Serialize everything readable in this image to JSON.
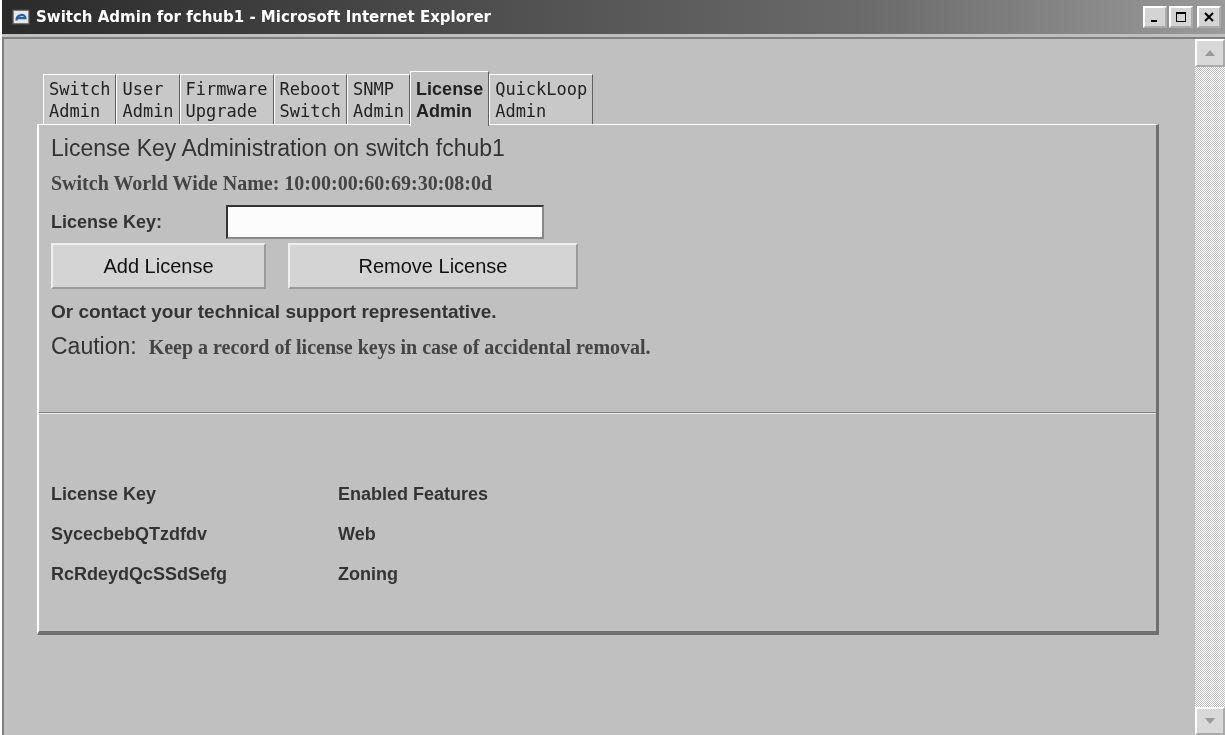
{
  "window": {
    "title": "Switch Admin for fchub1 - Microsoft Internet Explorer"
  },
  "tabs": [
    {
      "lines": [
        "Switch",
        "Admin"
      ],
      "selected": false
    },
    {
      "lines": [
        "User",
        "Admin"
      ],
      "selected": false
    },
    {
      "lines": [
        "Firmware",
        "Upgrade"
      ],
      "selected": false
    },
    {
      "lines": [
        "Reboot",
        "Switch"
      ],
      "selected": false
    },
    {
      "lines": [
        "SNMP",
        "Admin"
      ],
      "selected": false
    },
    {
      "lines": [
        "License",
        "Admin"
      ],
      "selected": true
    },
    {
      "lines": [
        "QuickLoop",
        "Admin"
      ],
      "selected": false
    }
  ],
  "heading": "License Key Administration on switch fchub1",
  "wwn": "Switch World Wide Name: 10:00:00:60:69:30:08:0d",
  "key_field": {
    "label": "License Key:"
  },
  "buttons": [
    "Add License",
    "Remove License"
  ],
  "contact": "Or contact your technical support representative.",
  "caution": {
    "label": "Caution:",
    "text": "Keep a record of license keys in case of accidental removal."
  },
  "table": {
    "columns": [
      "License Key",
      "Enabled Features"
    ],
    "rows": [
      [
        "SycecbebQTzdfdv",
        "Web"
      ],
      [
        "RcRdeydQcSSdSefg",
        "Zoning"
      ]
    ]
  }
}
